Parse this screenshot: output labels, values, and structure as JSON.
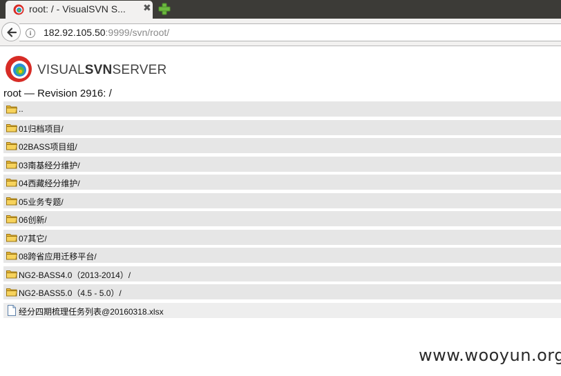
{
  "browser": {
    "tab": {
      "title": "root: / - VisualSVN S...",
      "close_glyph": "✖"
    },
    "new_tab_icon": "plus-icon",
    "url": {
      "host": "182.92.105.50",
      "rest": ":9999/svn/root/"
    }
  },
  "page": {
    "logo": {
      "part1": "VISUAL",
      "part2": "SVN",
      "part3": "SERVER"
    },
    "heading": "root — Revision 2916: /",
    "entries": [
      {
        "label": "..",
        "type": "folder"
      },
      {
        "label": "01归档项目/",
        "type": "folder"
      },
      {
        "label": "02BASS项目组/",
        "type": "folder"
      },
      {
        "label": "03南基经分维护/",
        "type": "folder"
      },
      {
        "label": "04西藏经分维护/",
        "type": "folder"
      },
      {
        "label": "05业务专题/",
        "type": "folder"
      },
      {
        "label": "06创新/",
        "type": "folder"
      },
      {
        "label": "07其它/",
        "type": "folder"
      },
      {
        "label": "08跨省应用迁移平台/",
        "type": "folder"
      },
      {
        "label": "NG2-BASS4.0（2013-2014）/",
        "type": "folder"
      },
      {
        "label": "NG2-BASS5.0（4.5 - 5.0）/",
        "type": "folder"
      },
      {
        "label": "经分四期梳理任务列表@20160318.xlsx",
        "type": "file"
      }
    ]
  },
  "watermark": "www.wooyun.org",
  "colors": {
    "tabstrip": "#3c3b37",
    "toolbar": "#f2f1f0",
    "row": "#e6e6e6",
    "folder": "#f7d35c",
    "logo_red": "#d72c26"
  }
}
